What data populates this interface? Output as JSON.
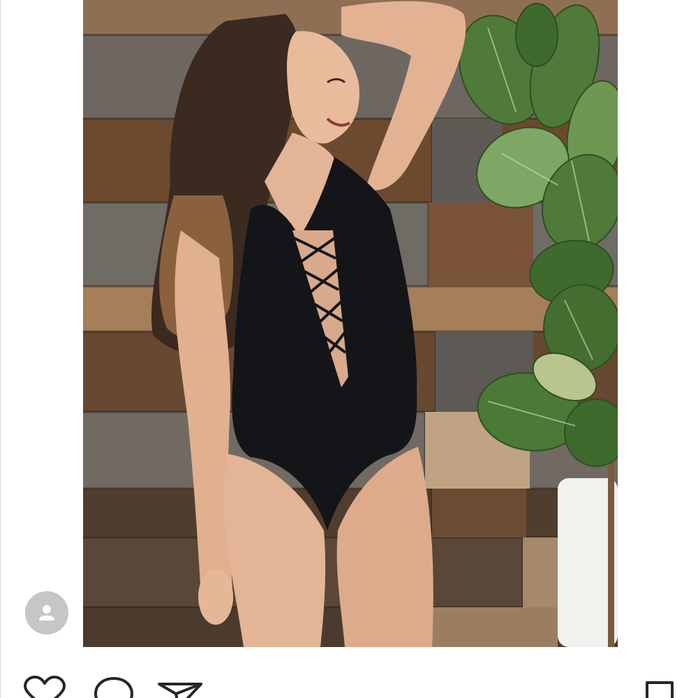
{
  "post": {
    "photo_icon": "post-photo",
    "avatar_icon": "default-user-avatar-icon",
    "photo_palette": {
      "wood_dark": "#4a3829",
      "wood_mid": "#7a5a3d",
      "wood_gray": "#6f6c66",
      "swimsuit": "#141518",
      "skin": "#e6b89a",
      "hair": "#3a2a20",
      "leaf": "#4f7a3a"
    }
  },
  "actions": {
    "like_icon": "heart-icon",
    "comment_icon": "comment-bubble-icon",
    "share_icon": "send-paper-plane-icon",
    "save_icon": "bookmark-icon"
  }
}
